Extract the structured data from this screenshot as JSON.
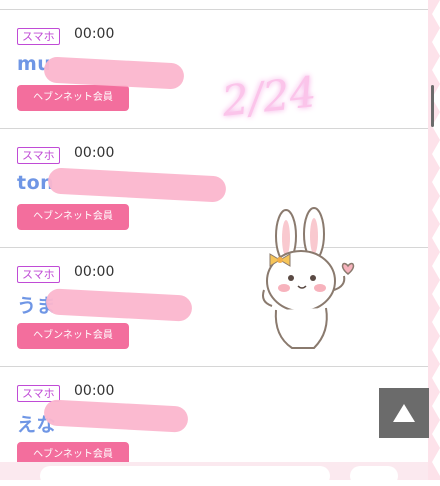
{
  "cards": [
    {
      "device": "スマホ",
      "time": "00:00",
      "name": "mu",
      "badge": "ヘブンネット会員"
    },
    {
      "device": "スマホ",
      "time": "00:00",
      "name": "ton",
      "badge": "ヘブンネット会員"
    },
    {
      "device": "スマホ",
      "time": "00:00",
      "name": "うま",
      "badge": "ヘブンネット会員"
    },
    {
      "device": "スマホ",
      "time": "00:00",
      "name": "えな",
      "badge": "ヘブンネット会員"
    }
  ],
  "overlay": {
    "date": "2/24"
  },
  "scroll_top": {
    "icon": "up-arrow-icon"
  },
  "colors": {
    "accent": "#f36e9d",
    "device_badge": "#c04bd6",
    "name": "#6f96e5",
    "scribble": "#fbb6cd"
  }
}
